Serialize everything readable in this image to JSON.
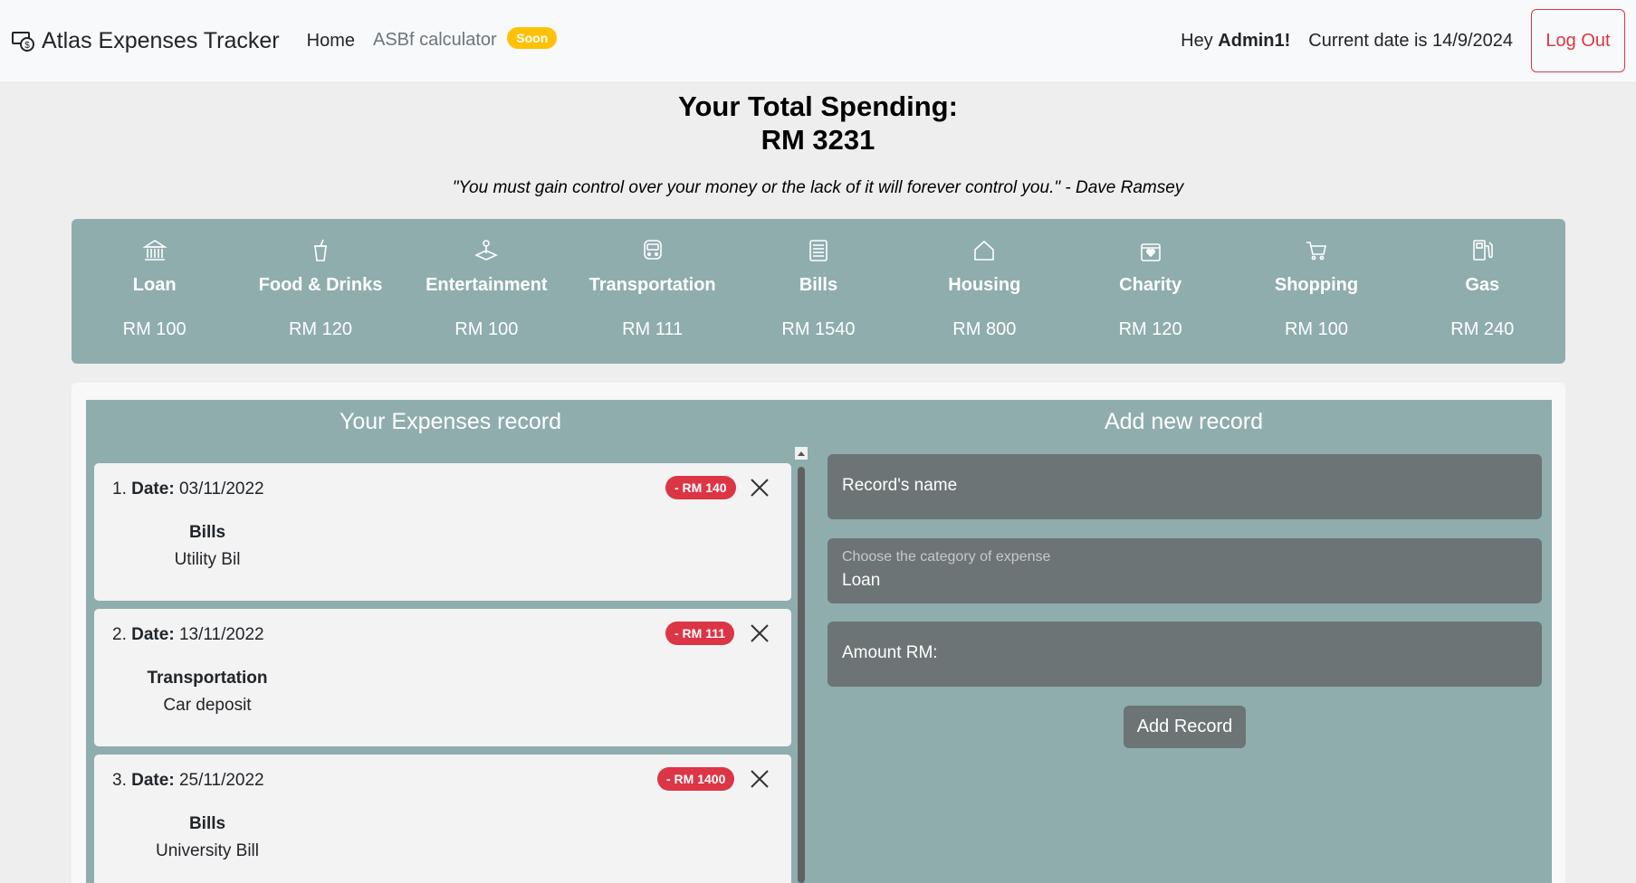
{
  "navbar": {
    "brand": "Atlas Expenses Tracker",
    "links": [
      "Home",
      "ASBf calculator"
    ],
    "soon_badge": "Soon",
    "greeting_prefix": "Hey",
    "username": "Admin1!",
    "current_date_text": "Current date is 14/9/2024",
    "logout_label": "Log Out"
  },
  "header": {
    "title": "Your Total Spending:",
    "total": "RM 3231",
    "quote": "\"You must gain control over your money or the lack of it will forever control you.\" - Dave Ramsey"
  },
  "categories": [
    {
      "name": "Loan",
      "amount": "RM 100",
      "icon": "bank-icon"
    },
    {
      "name": "Food & Drinks",
      "amount": "RM 120",
      "icon": "cup-icon"
    },
    {
      "name": "Entertainment",
      "amount": "RM 100",
      "icon": "joystick-icon"
    },
    {
      "name": "Transportation",
      "amount": "RM 111",
      "icon": "train-icon"
    },
    {
      "name": "Bills",
      "amount": "RM 1540",
      "icon": "receipt-icon"
    },
    {
      "name": "Housing",
      "amount": "RM 800",
      "icon": "house-icon"
    },
    {
      "name": "Charity",
      "amount": "RM 120",
      "icon": "charity-box-icon"
    },
    {
      "name": "Shopping",
      "amount": "RM 100",
      "icon": "cart-icon"
    },
    {
      "name": "Gas",
      "amount": "RM 240",
      "icon": "fuel-pump-icon"
    }
  ],
  "records": {
    "title": "Your Expenses record",
    "date_label": "Date:",
    "items": [
      {
        "index": "1.",
        "date": "03/11/2022",
        "amount": "- RM 140",
        "category": "Bills",
        "name": "Utility Bil"
      },
      {
        "index": "2.",
        "date": "13/11/2022",
        "amount": "- RM 111",
        "category": "Transportation",
        "name": "Car deposit"
      },
      {
        "index": "3.",
        "date": "25/11/2022",
        "amount": "- RM 1400",
        "category": "Bills",
        "name": "University Bill"
      }
    ]
  },
  "add_form": {
    "title": "Add new record",
    "name_label": "Record's name",
    "category_hint": "Choose the category of expense",
    "category_value": "Loan",
    "amount_label": "Amount RM:",
    "submit_label": "Add Record"
  },
  "colors": {
    "panel": "#8fadad",
    "danger": "#dc3545",
    "warning": "#ffc107",
    "field": "#6c7476"
  }
}
